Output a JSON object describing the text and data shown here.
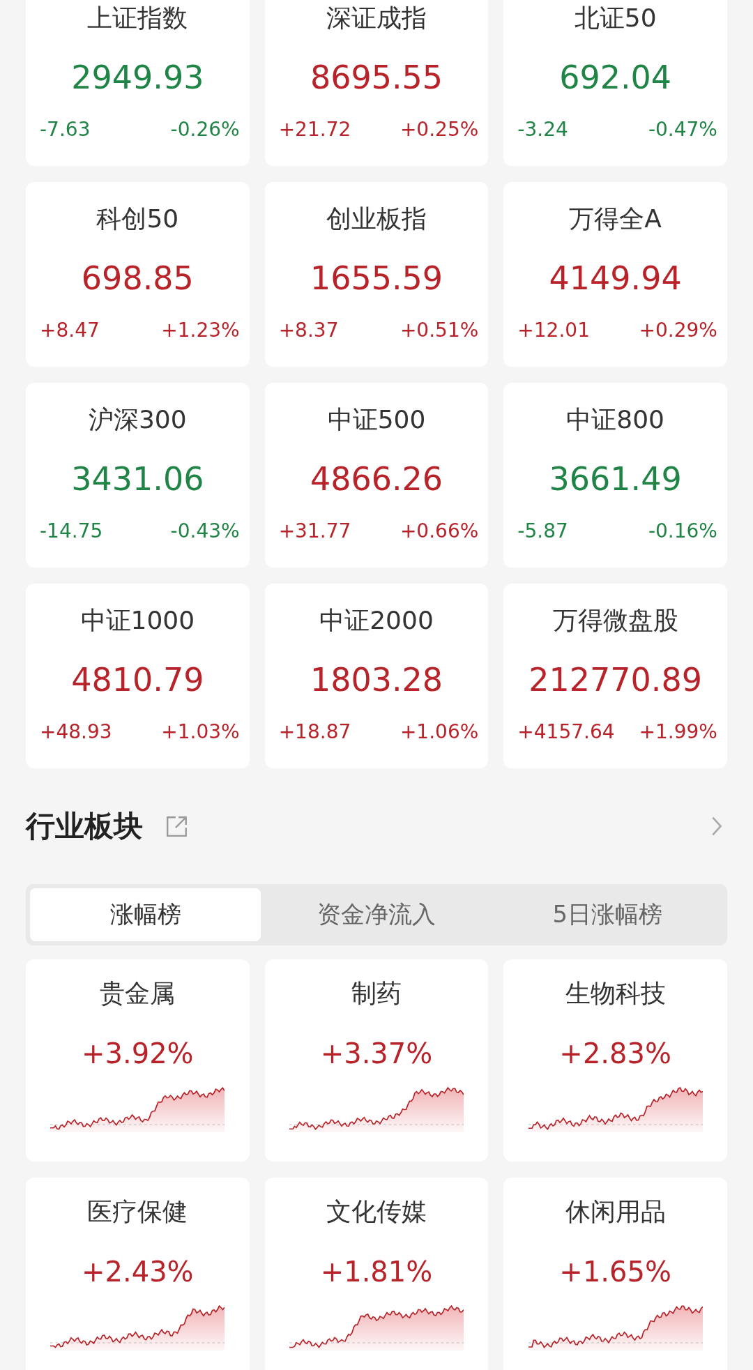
{
  "indices": [
    {
      "name": "上证指数",
      "price": "2949.93",
      "change": "-7.63",
      "percent": "-0.26%",
      "color": "#1f8446"
    },
    {
      "name": "深证成指",
      "price": "8695.55",
      "change": "+21.72",
      "percent": "+0.25%",
      "color": "#b8232a"
    },
    {
      "name": "北证50",
      "price": "692.04",
      "change": "-3.24",
      "percent": "-0.47%",
      "color": "#1f8446"
    },
    {
      "name": "科创50",
      "price": "698.85",
      "change": "+8.47",
      "percent": "+1.23%",
      "color": "#b8232a"
    },
    {
      "name": "创业板指",
      "price": "1655.59",
      "change": "+8.37",
      "percent": "+0.51%",
      "color": "#b8232a"
    },
    {
      "name": "万得全A",
      "price": "4149.94",
      "change": "+12.01",
      "percent": "+0.29%",
      "color": "#b8232a"
    },
    {
      "name": "沪深300",
      "price": "3431.06",
      "change": "-14.75",
      "percent": "-0.43%",
      "color": "#1f8446"
    },
    {
      "name": "中证500",
      "price": "4866.26",
      "change": "+31.77",
      "percent": "+0.66%",
      "color": "#b8232a"
    },
    {
      "name": "中证800",
      "price": "3661.49",
      "change": "-5.87",
      "percent": "-0.16%",
      "color": "#1f8446"
    },
    {
      "name": "中证1000",
      "price": "4810.79",
      "change": "+48.93",
      "percent": "+1.03%",
      "color": "#b8232a"
    },
    {
      "name": "中证2000",
      "price": "1803.28",
      "change": "+18.87",
      "percent": "+1.06%",
      "color": "#b8232a"
    },
    {
      "name": "万得微盘股",
      "price": "212770.89",
      "change": "+4157.64",
      "percent": "+1.99%",
      "color": "#b8232a"
    }
  ],
  "industry": {
    "title": "行业板块",
    "tabs": [
      {
        "label": "涨幅榜",
        "selected": true
      },
      {
        "label": "资金净流入",
        "selected": false
      },
      {
        "label": "5日涨幅榜",
        "selected": false
      }
    ],
    "sectors": [
      {
        "name": "贵金属",
        "percent": "+3.92%",
        "color": "#b8232a"
      },
      {
        "name": "制药",
        "percent": "+3.37%",
        "color": "#b8232a"
      },
      {
        "name": "生物科技",
        "percent": "+2.83%",
        "color": "#b8232a"
      },
      {
        "name": "医疗保健",
        "percent": "+2.43%",
        "color": "#b8232a"
      },
      {
        "name": "文化传媒",
        "percent": "+1.81%",
        "color": "#b8232a"
      },
      {
        "name": "休闲用品",
        "percent": "+1.65%",
        "color": "#b8232a"
      }
    ]
  }
}
